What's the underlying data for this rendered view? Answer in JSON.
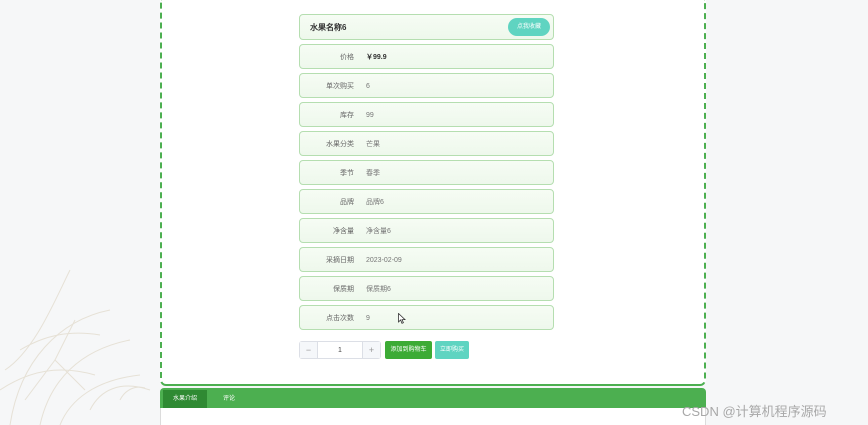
{
  "product": {
    "title": "水果名称6",
    "favorite_label": "点我收藏",
    "rows": [
      {
        "label": "价格",
        "value": "￥99.9"
      },
      {
        "label": "单次购买",
        "value": "6"
      },
      {
        "label": "库存",
        "value": "99"
      },
      {
        "label": "水果分类",
        "value": "芒果"
      },
      {
        "label": "季节",
        "value": "春季"
      },
      {
        "label": "品牌",
        "value": "品牌6"
      },
      {
        "label": "净含量",
        "value": "净含量6"
      },
      {
        "label": "采摘日期",
        "value": "2023-02-09"
      },
      {
        "label": "保质期",
        "value": "保质期6"
      },
      {
        "label": "点击次数",
        "value": "9"
      }
    ]
  },
  "purchase": {
    "minus": "−",
    "quantity": "1",
    "plus": "+",
    "add_to_cart": "添加到购物车",
    "buy_now": "立即购买"
  },
  "tabs": [
    {
      "label": "水果介绍"
    },
    {
      "label": "评论"
    }
  ],
  "watermark": "CSDN @计算机程序源码",
  "colors": {
    "accent_green": "#4caf50",
    "button_green": "#3cab35",
    "teal": "#5fd4c1"
  }
}
